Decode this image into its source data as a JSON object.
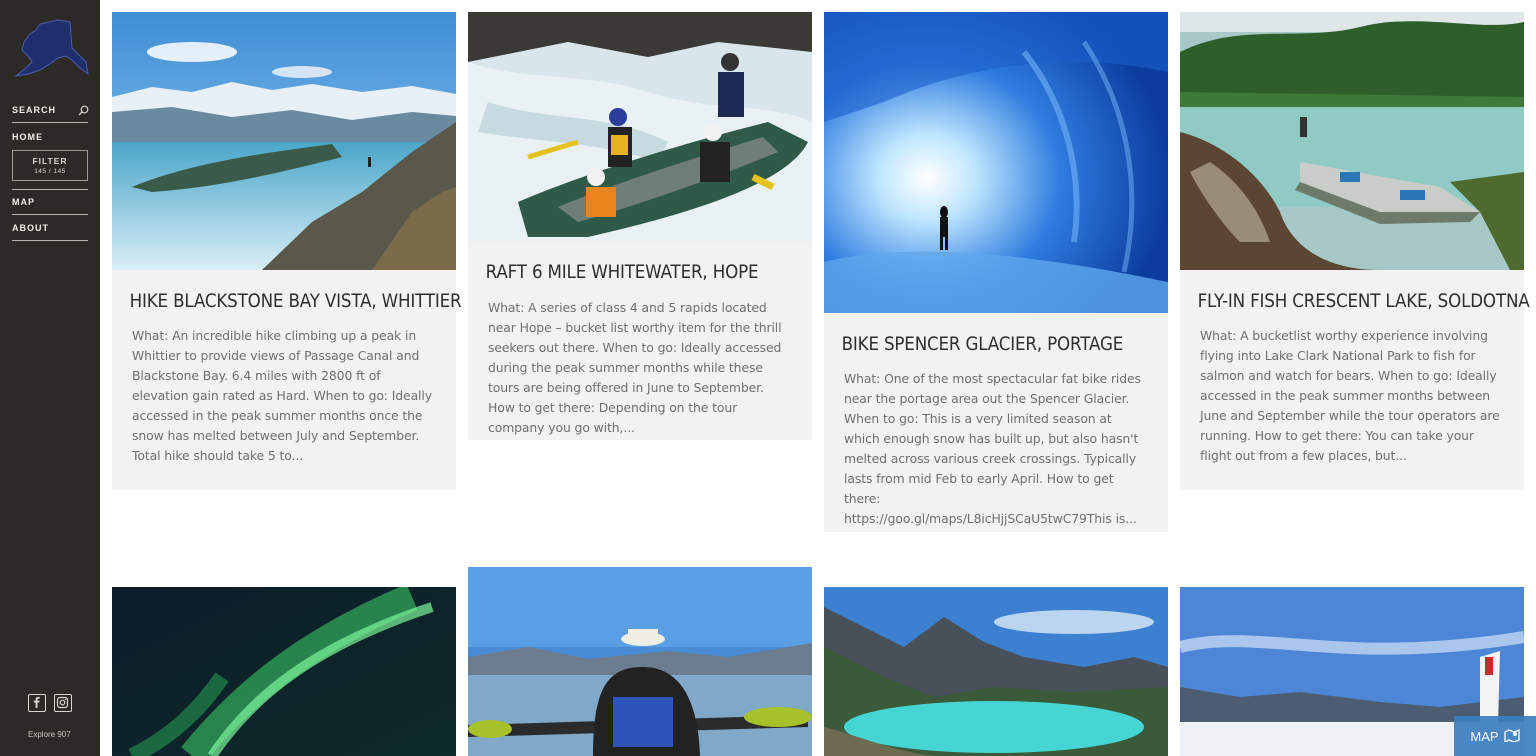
{
  "sidebar": {
    "nav": {
      "search": "SEARCH",
      "home": "HOME",
      "filter": "FILTER",
      "filter_count": "145 / 145",
      "map": "MAP",
      "about": "ABOUT"
    },
    "brand": "Explore 907"
  },
  "cards": [
    {
      "title": "HIKE BLACKSTONE BAY VISTA, WHITTIER",
      "excerpt": "What: An incredible hike climbing up a peak in Whittier to provide views of Passage Canal and Blackstone Bay. 6.4 miles with 2800 ft of elevation gain rated as Hard. When to go: Ideally accessed in the peak summer months once the snow has melted between July and September. Total hike should take 5 to..."
    },
    {
      "title": "RAFT 6 MILE WHITEWATER, HOPE",
      "excerpt": "What: A series of class 4 and 5 rapids located near Hope – bucket list worthy item for the thrill seekers out there. When to go: Ideally accessed during the peak summer months while these tours are being offered in June to September. How to get there: Depending on the tour company you go with,..."
    },
    {
      "title": "BIKE SPENCER GLACIER, PORTAGE",
      "excerpt": "What: One of the most spectacular fat bike rides near the portage area out the Spencer Glacier. When to go: This is a very limited season at which enough snow has built up, but also hasn't melted across various creek crossings. Typically lasts from mid Feb to early April. How to get there: https://goo.gl/maps/L8icHjjSCaU5twC79This is..."
    },
    {
      "title": "FLY-IN FISH CRESCENT LAKE, SOLDOTNA",
      "excerpt": "What: A bucketlist worthy experience involving flying into Lake Clark National Park to fish for salmon and watch for bears. When to go: Ideally accessed in the peak summer months between June and September while the tour operators are running. How to get there: You can take your flight out from a few places, but..."
    }
  ],
  "map_button": "MAP"
}
